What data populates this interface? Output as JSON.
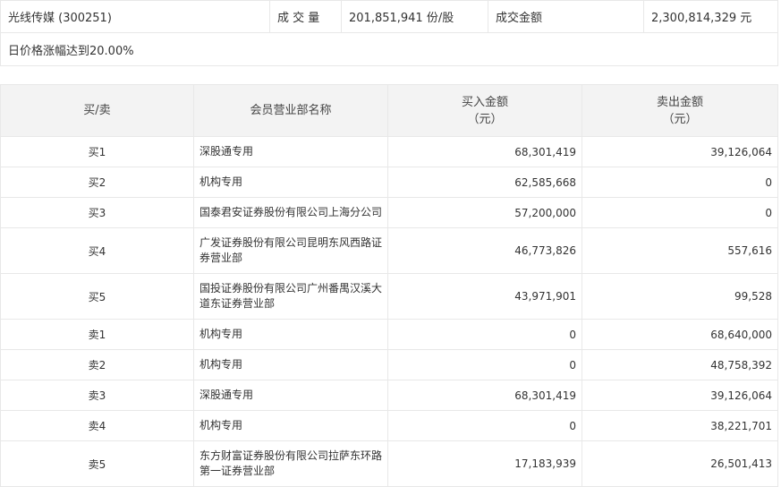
{
  "summary": {
    "stock": "光线传媒 (300251)",
    "volume_label": "成 交 量",
    "volume_value": "201,851,941 份/股",
    "amount_label": "成交金额",
    "amount_value": "2,300,814,329 元",
    "note": "日价格涨幅达到20.00%"
  },
  "table": {
    "headers": {
      "side": "买/卖",
      "dept": "会员营业部名称",
      "buy_line1": "买入金额",
      "buy_line2": "（元）",
      "sell_line1": "卖出金额",
      "sell_line2": "（元）"
    },
    "rows": [
      {
        "side": "买1",
        "dept_line1": "深股通专用",
        "dept_line2": "",
        "buy": "68,301,419",
        "sell": "39,126,064"
      },
      {
        "side": "买2",
        "dept_line1": "机构专用",
        "dept_line2": "",
        "buy": "62,585,668",
        "sell": "0"
      },
      {
        "side": "买3",
        "dept_line1": "国泰君安证券股份有限公司上海分公司",
        "dept_line2": "",
        "buy": "57,200,000",
        "sell": "0"
      },
      {
        "side": "买4",
        "dept_line1": "广发证券股份有限公司昆明东风西路证",
        "dept_line2": "券营业部",
        "buy": "46,773,826",
        "sell": "557,616"
      },
      {
        "side": "买5",
        "dept_line1": "国投证券股份有限公司广州番禺汉溪大",
        "dept_line2": "道东证券营业部",
        "buy": "43,971,901",
        "sell": "99,528"
      },
      {
        "side": "卖1",
        "dept_line1": "机构专用",
        "dept_line2": "",
        "buy": "0",
        "sell": "68,640,000"
      },
      {
        "side": "卖2",
        "dept_line1": "机构专用",
        "dept_line2": "",
        "buy": "0",
        "sell": "48,758,392"
      },
      {
        "side": "卖3",
        "dept_line1": "深股通专用",
        "dept_line2": "",
        "buy": "68,301,419",
        "sell": "39,126,064"
      },
      {
        "side": "卖4",
        "dept_line1": "机构专用",
        "dept_line2": "",
        "buy": "0",
        "sell": "38,221,701"
      },
      {
        "side": "卖5",
        "dept_line1": "东方财富证券股份有限公司拉萨东环路",
        "dept_line2": "第一证券营业部",
        "buy": "17,183,939",
        "sell": "26,501,413"
      }
    ]
  }
}
